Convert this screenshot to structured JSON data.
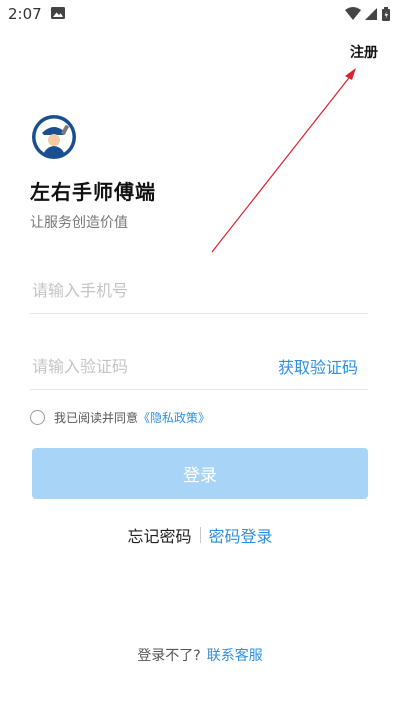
{
  "status_bar": {
    "time": "2:07"
  },
  "header": {
    "register_label": "注册"
  },
  "app": {
    "title": "左右手师傅端",
    "subtitle": "让服务创造价值"
  },
  "form": {
    "phone_placeholder": "请输入手机号",
    "code_placeholder": "请输入验证码",
    "get_code_label": "获取验证码",
    "agreement_text": "我已阅读并同意",
    "privacy_link": "《隐私政策》",
    "login_label": "登录"
  },
  "links": {
    "forgot_password": "忘记密码",
    "password_login": "密码登录"
  },
  "help": {
    "text": "登录不了?",
    "service_link": "联系客服"
  },
  "colors": {
    "accent": "#2f8fe0",
    "button_disabled": "#a8d4f7",
    "annotation_arrow": "#d9232e"
  }
}
